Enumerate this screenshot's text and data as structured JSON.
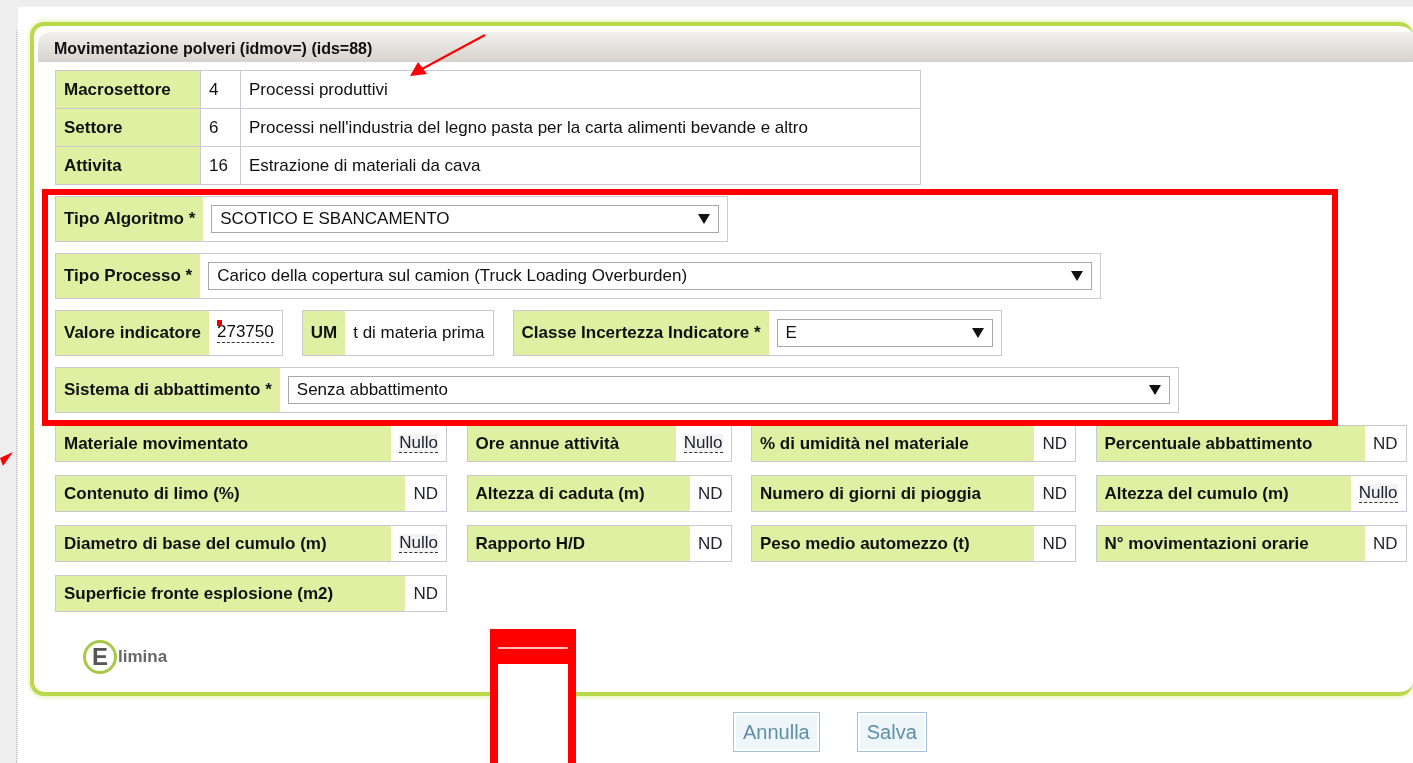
{
  "panel": {
    "title": "Movimentazione polveri (idmov=) (ids=88)"
  },
  "info_rows": [
    {
      "label": "Macrosettore",
      "code": "4",
      "description": "Processi produttivi"
    },
    {
      "label": "Settore",
      "code": "6",
      "description": "Processi nell'industria del legno pasta per la carta alimenti bevande e altro"
    },
    {
      "label": "Attivita",
      "code": "16",
      "description": "Estrazione di materiali da cava"
    }
  ],
  "algorithm_rows": [
    [
      {
        "kind": "select",
        "label": "Tipo Algoritmo *",
        "value": "SCOTICO E SBANCAMENTO"
      }
    ],
    [
      {
        "kind": "select",
        "label": "Tipo Processo *",
        "value": "Carico della copertura sul camion (Truck Loading Overburden)"
      }
    ],
    [
      {
        "kind": "input",
        "label": "Valore indicatore",
        "value": "273750"
      },
      {
        "kind": "text",
        "label": "UM",
        "value": "t di materia prima"
      },
      {
        "kind": "select",
        "label": "Classe Incertezza Indicatore *",
        "value": "E"
      }
    ],
    [
      {
        "kind": "select",
        "label": "Sistema di abbattimento *",
        "value": "Senza abbattimento"
      }
    ]
  ],
  "parameters": [
    {
      "label": "Materiale movimentato",
      "value": "Nullo",
      "editable": true
    },
    {
      "label": "Ore annue attività",
      "value": "Nullo",
      "editable": true
    },
    {
      "label": "% di umidità nel materiale",
      "value": "ND",
      "editable": false
    },
    {
      "label": "Percentuale abbattimento",
      "value": "ND",
      "editable": false
    },
    {
      "label": "Contenuto di limo (%)",
      "value": "ND",
      "editable": false
    },
    {
      "label": "Altezza di caduta (m)",
      "value": "ND",
      "editable": false
    },
    {
      "label": "Numero di giorni di pioggia",
      "value": "ND",
      "editable": false
    },
    {
      "label": "Altezza del cumulo (m)",
      "value": "Nullo",
      "editable": true
    },
    {
      "label": "Diametro di base del cumulo (m)",
      "value": "Nullo",
      "editable": true
    },
    {
      "label": "Rapporto H/D",
      "value": "ND",
      "editable": false
    },
    {
      "label": "Peso medio automezzo (t)",
      "value": "ND",
      "editable": false
    },
    {
      "label": "N° movimentazioni orarie",
      "value": "ND",
      "editable": false
    },
    {
      "label": "Superficie fronte esplosione (m2)",
      "value": "ND",
      "editable": false
    }
  ],
  "delete_link": {
    "icon_letter": "E",
    "label": "limina"
  },
  "buttons": [
    "Annulla",
    "Salva"
  ]
}
